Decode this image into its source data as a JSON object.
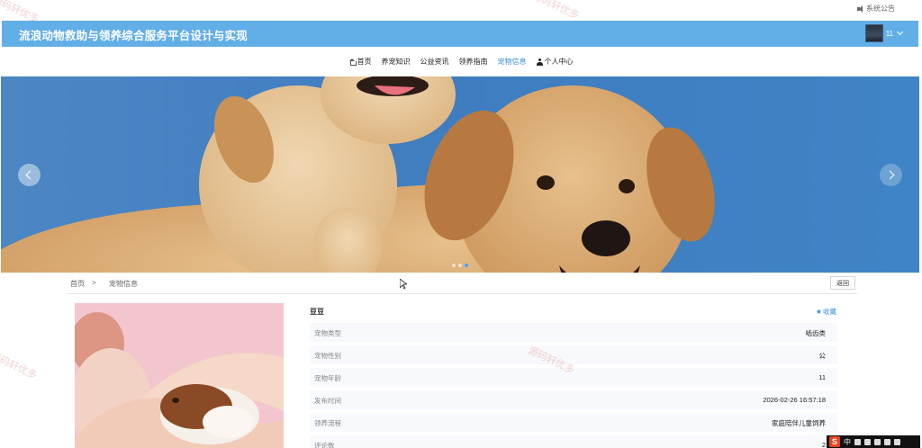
{
  "system_notice": "系统公告",
  "header": {
    "title": "流浪动物救助与领养综合服务平台设计与实现",
    "user_name": "11"
  },
  "nav": {
    "items": [
      {
        "label": "首页",
        "icon": "home-icon"
      },
      {
        "label": "养宠知识"
      },
      {
        "label": "公益资讯"
      },
      {
        "label": "领养指南"
      },
      {
        "label": "宠物信息",
        "active": true
      },
      {
        "label": "个人中心",
        "icon": "person-icon"
      }
    ]
  },
  "banner": {
    "slide_count": 3,
    "active_slide": 3
  },
  "breadcrumb": {
    "home": "首页",
    "separator": ">",
    "current": "宠物信息"
  },
  "back_label": "返回",
  "detail": {
    "name": "豆豆",
    "favorite_label": "收藏",
    "fields": [
      {
        "label": "宠物类型",
        "value": "啮齿类"
      },
      {
        "label": "宠物性别",
        "value": "公"
      },
      {
        "label": "宠物年龄",
        "value": "11"
      },
      {
        "label": "发布时间",
        "value": "2026-02-26 16:57:18"
      },
      {
        "label": "领养流程",
        "value": "家庭陪伴儿童饲养"
      },
      {
        "label": "评论数",
        "value": "2"
      }
    ]
  },
  "watermark": "源码轩优多",
  "taskbar": {
    "ime": "S",
    "lang": "中"
  },
  "colors": {
    "header": "#62aee6",
    "accent": "#3a8ee6"
  }
}
